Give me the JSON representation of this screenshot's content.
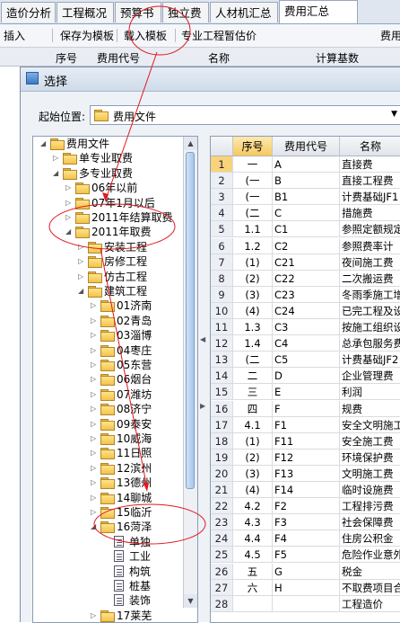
{
  "tabs": [
    "造价分析",
    "工程概况",
    "预算书",
    "独立费",
    "人材机汇总",
    "费用汇总"
  ],
  "toolbar": {
    "insert": "插入",
    "save_template": "保存为模板",
    "load_template": "载入模板",
    "exam_price": "专业工程暂估价",
    "cut_text": "费用"
  },
  "bg_header": {
    "seq": "序号",
    "code": "费用代号",
    "name": "名称",
    "base": "计算基数"
  },
  "dialog": {
    "title": "选择",
    "start_label": "起始位置:",
    "start_value": "费用文件"
  },
  "tree": [
    {
      "label": "费用文件",
      "depth": 0,
      "expanded": true,
      "icon": "folder"
    },
    {
      "label": "单专业取费",
      "depth": 1,
      "expanded": false,
      "icon": "folder"
    },
    {
      "label": "多专业取费",
      "depth": 1,
      "expanded": true,
      "icon": "folder"
    },
    {
      "label": "06年以前",
      "depth": 2,
      "expanded": false,
      "icon": "folder"
    },
    {
      "label": "07年1月以后",
      "depth": 2,
      "expanded": false,
      "icon": "folder"
    },
    {
      "label": "2011年结算取费",
      "depth": 2,
      "expanded": false,
      "icon": "folder"
    },
    {
      "label": "2011年取费",
      "depth": 2,
      "expanded": true,
      "icon": "folder"
    },
    {
      "label": "安装工程",
      "depth": 3,
      "expanded": false,
      "icon": "folder"
    },
    {
      "label": "房修工程",
      "depth": 3,
      "expanded": false,
      "icon": "folder"
    },
    {
      "label": "仿古工程",
      "depth": 3,
      "expanded": false,
      "icon": "folder"
    },
    {
      "label": "建筑工程",
      "depth": 3,
      "expanded": true,
      "icon": "folder"
    },
    {
      "label": "01济南",
      "depth": 4,
      "expanded": false,
      "icon": "folder"
    },
    {
      "label": "02青岛",
      "depth": 4,
      "expanded": false,
      "icon": "folder"
    },
    {
      "label": "03淄博",
      "depth": 4,
      "expanded": false,
      "icon": "folder"
    },
    {
      "label": "04枣庄",
      "depth": 4,
      "expanded": false,
      "icon": "folder"
    },
    {
      "label": "05东营",
      "depth": 4,
      "expanded": false,
      "icon": "folder"
    },
    {
      "label": "06烟台",
      "depth": 4,
      "expanded": false,
      "icon": "folder"
    },
    {
      "label": "07潍坊",
      "depth": 4,
      "expanded": false,
      "icon": "folder"
    },
    {
      "label": "08济宁",
      "depth": 4,
      "expanded": false,
      "icon": "folder"
    },
    {
      "label": "09泰安",
      "depth": 4,
      "expanded": false,
      "icon": "folder"
    },
    {
      "label": "10威海",
      "depth": 4,
      "expanded": false,
      "icon": "folder"
    },
    {
      "label": "11日照",
      "depth": 4,
      "expanded": false,
      "icon": "folder"
    },
    {
      "label": "12滨州",
      "depth": 4,
      "expanded": false,
      "icon": "folder"
    },
    {
      "label": "13德州",
      "depth": 4,
      "expanded": false,
      "icon": "folder"
    },
    {
      "label": "14聊城",
      "depth": 4,
      "expanded": false,
      "icon": "folder"
    },
    {
      "label": "15临沂",
      "depth": 4,
      "expanded": false,
      "icon": "folder"
    },
    {
      "label": "16菏泽",
      "depth": 4,
      "expanded": true,
      "icon": "folder"
    },
    {
      "label": "单独",
      "depth": 5,
      "expanded": null,
      "icon": "doc"
    },
    {
      "label": "工业",
      "depth": 5,
      "expanded": null,
      "icon": "doc"
    },
    {
      "label": "构筑",
      "depth": 5,
      "expanded": null,
      "icon": "doc"
    },
    {
      "label": "桩基",
      "depth": 5,
      "expanded": null,
      "icon": "doc"
    },
    {
      "label": "装饰",
      "depth": 5,
      "expanded": null,
      "icon": "doc"
    },
    {
      "label": "17莱芜",
      "depth": 4,
      "expanded": false,
      "icon": "folder"
    },
    {
      "label": "市政工程",
      "depth": 3,
      "expanded": false,
      "icon": "folder"
    }
  ],
  "grid": {
    "headers": [
      "",
      "序号",
      "费用代号",
      "名称"
    ],
    "rows": [
      [
        "1",
        "一",
        "A",
        "直接费"
      ],
      [
        "2",
        "(一",
        "B",
        "直接工程费"
      ],
      [
        "3",
        "(一",
        "B1",
        "计费基础JF1"
      ],
      [
        "4",
        "(二",
        "C",
        "措施费"
      ],
      [
        "5",
        "1.1",
        "C1",
        "参照定额规定"
      ],
      [
        "6",
        "1.2",
        "C2",
        "参照费率计"
      ],
      [
        "7",
        "(1)",
        "C21",
        "夜间施工费"
      ],
      [
        "8",
        "(2)",
        "C22",
        "二次搬运费"
      ],
      [
        "9",
        "(3)",
        "C23",
        "冬雨季施工增"
      ],
      [
        "10",
        "(4)",
        "C24",
        "已完工程及设"
      ],
      [
        "11",
        "1.3",
        "C3",
        "按施工组织设"
      ],
      [
        "12",
        "1.4",
        "C4",
        "总承包服务费"
      ],
      [
        "13",
        "(二",
        "C5",
        "计费基础JF2"
      ],
      [
        "14",
        "二",
        "D",
        "企业管理费"
      ],
      [
        "15",
        "三",
        "E",
        "利润"
      ],
      [
        "16",
        "四",
        "F",
        "规费"
      ],
      [
        "17",
        "4.1",
        "F1",
        "安全文明施工"
      ],
      [
        "18",
        "(1)",
        "F11",
        "安全施工费"
      ],
      [
        "19",
        "(2)",
        "F12",
        "环境保护费"
      ],
      [
        "20",
        "(3)",
        "F13",
        "文明施工费"
      ],
      [
        "21",
        "(4)",
        "F14",
        "临时设施费"
      ],
      [
        "22",
        "4.2",
        "F2",
        "工程排污费"
      ],
      [
        "23",
        "4.3",
        "F3",
        "社会保障费"
      ],
      [
        "24",
        "4.4",
        "F4",
        "住房公积金"
      ],
      [
        "25",
        "4.5",
        "F5",
        "危险作业意外"
      ],
      [
        "26",
        "五",
        "G",
        "税金"
      ],
      [
        "27",
        "六",
        "H",
        "不取费项目合"
      ],
      [
        "28",
        "",
        "",
        "工程造价"
      ]
    ]
  },
  "colors": {
    "annotation": "#e0191f",
    "folder": "#f2c24a",
    "selected_header": "#f6c95c"
  }
}
